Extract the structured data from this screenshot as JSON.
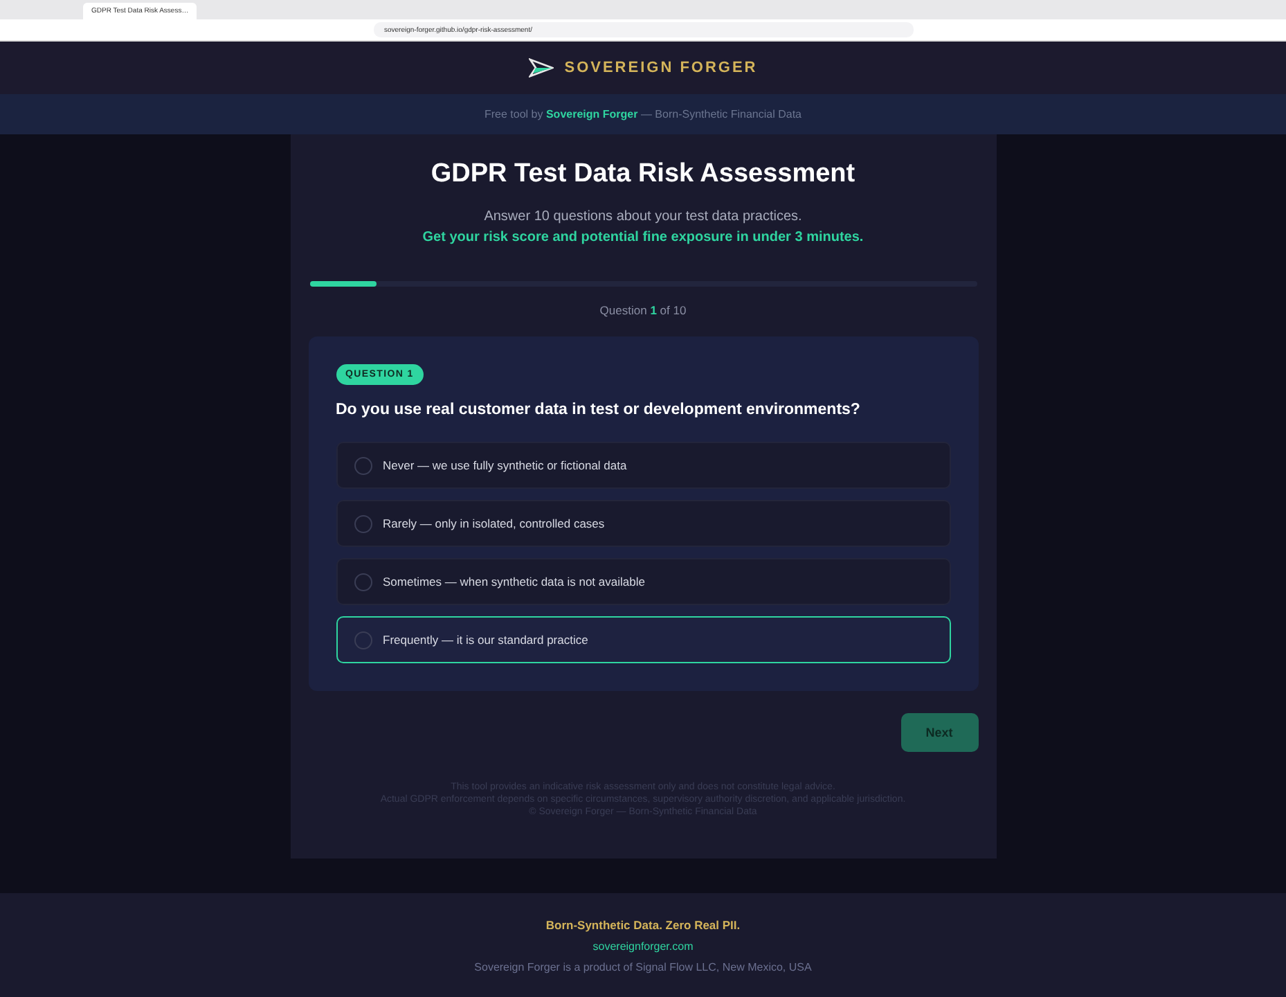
{
  "browser": {
    "tab_title": "GDPR Test Data Risk Assess…",
    "url": "sovereign-forger.github.io/gdpr-risk-assessment/"
  },
  "header": {
    "brand": "SOVEREIGN FORGER"
  },
  "banner": {
    "prefix": "Free tool by",
    "link": "Sovereign Forger",
    "suffix": "— Born-Synthetic Financial Data"
  },
  "intro": {
    "title": "GDPR Test Data Risk Assessment",
    "subtitle": "Answer 10 questions about your test data practices.",
    "highlight": "Get your risk score and potential fine exposure in under 3 minutes."
  },
  "progress": {
    "level": 0.1,
    "label": "Question **1** of 10"
  },
  "question": {
    "badge": "QUESTION 1",
    "text": "Do you use real customer data in test or development environments?",
    "options": [
      {
        "label": "Never — we use fully synthetic or fictional data",
        "selected": false,
        "hovered": false
      },
      {
        "label": "Rarely — only in isolated, controlled cases",
        "selected": false,
        "hovered": false
      },
      {
        "label": "Sometimes — when synthetic data is not available",
        "selected": false,
        "hovered": false
      },
      {
        "label": "Frequently — it is our standard practice",
        "selected": false,
        "hovered": true
      }
    ]
  },
  "next_button": {
    "label": "Next",
    "disabled": true
  },
  "disclaimer": [
    "This tool provides an indicative risk assessment only and does not constitute legal advice.",
    "Actual GDPR enforcement depends on specific circumstances, supervisory authority discretion, and applicable jurisdiction.",
    "© Sovereign Forger — Born-Synthetic Financial Data"
  ],
  "footer": {
    "tagline": "Born-Synthetic Data. Zero Real PII.",
    "link": "sovereignforger.com",
    "note": "Sovereign Forger is a product of Signal Flow LLC, New Mexico, USA"
  }
}
